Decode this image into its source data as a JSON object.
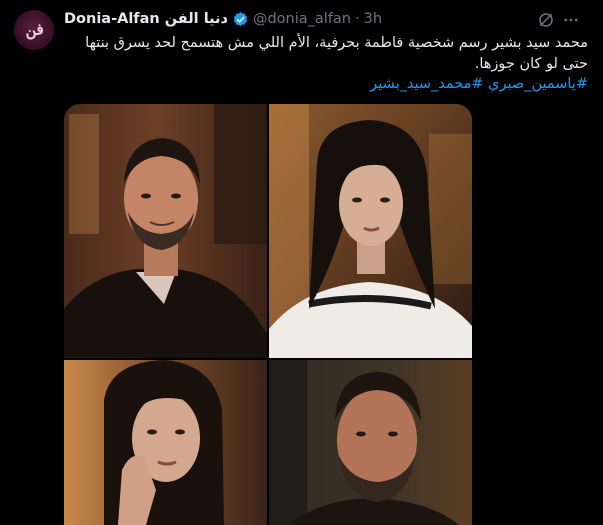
{
  "tweet": {
    "display_name": "Donia-Alfan دنيا الفن",
    "handle": "@donia_alfan",
    "separator": "·",
    "time": "3h",
    "text_lines": [
      "محمد سيد بشير رسم شخصية فاطمة بحرفية، الأم اللي مش هتسمح لحد يسرق بنتها",
      "حتى لو كان جوزها."
    ],
    "hashtags": "#ياسمين_صبري #محمد_سيد_بشير"
  },
  "avatar": {
    "glyph": "فن"
  },
  "icons": {
    "verified": "verified-badge-icon",
    "grok": "grok-icon",
    "more": "more-options-icon"
  },
  "media": {
    "images": [
      {
        "name": "man-in-suit-smiling-photo"
      },
      {
        "name": "woman-white-sweater-photo"
      },
      {
        "name": "woman-hand-on-chin-photo"
      },
      {
        "name": "man-close-up-photo"
      }
    ]
  },
  "colors": {
    "accent": "#1d9bf0",
    "text": "#e7e9ea",
    "muted": "#71767b",
    "background": "#000000"
  }
}
